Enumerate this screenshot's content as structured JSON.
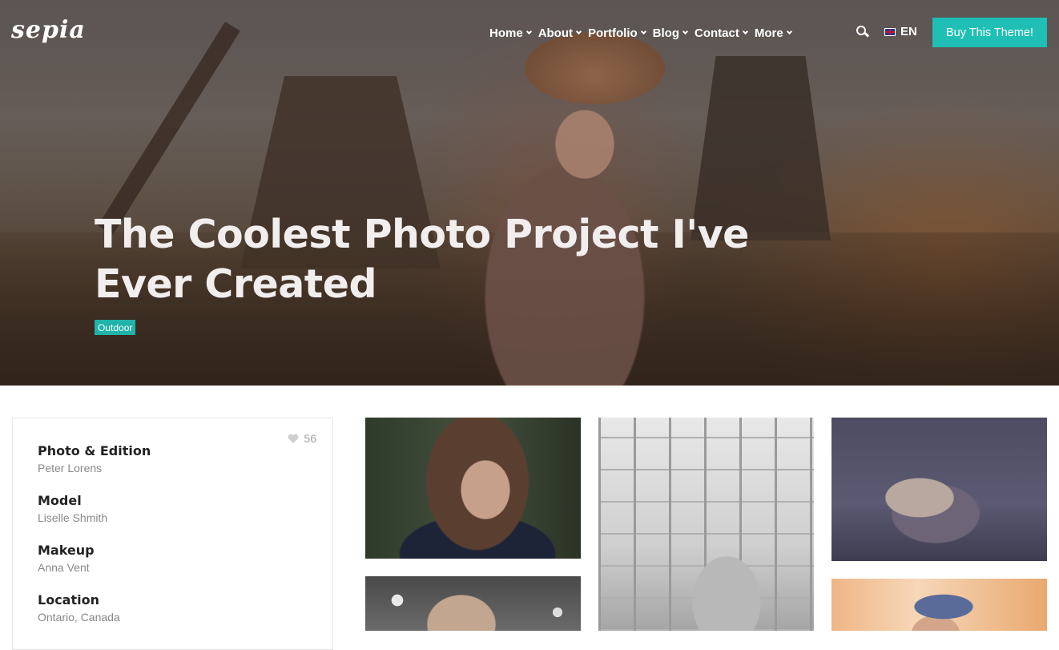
{
  "brand": {
    "logo": "sepia"
  },
  "nav": {
    "items": [
      {
        "label": "Home"
      },
      {
        "label": "About"
      },
      {
        "label": "Portfolio"
      },
      {
        "label": "Blog"
      },
      {
        "label": "Contact"
      },
      {
        "label": "More"
      }
    ],
    "search_icon": "search-icon",
    "language": {
      "code": "EN",
      "flag_icon": "uk-flag-icon"
    },
    "cta_label": "Buy This Theme!",
    "cta_color": "#1fbfb5"
  },
  "hero": {
    "title": "The Coolest Photo Project I've Ever Created",
    "tag": "Outdoor"
  },
  "project": {
    "likes": "56",
    "like_icon": "heart-icon",
    "details": [
      {
        "label": "Photo & Edition",
        "value": "Peter Lorens"
      },
      {
        "label": "Model",
        "value": "Liselle Shmith"
      },
      {
        "label": "Makeup",
        "value": "Anna Vent"
      },
      {
        "label": "Location",
        "value": "Ontario, Canada"
      }
    ]
  },
  "gallery": {
    "accent": "#1fb3a9"
  }
}
